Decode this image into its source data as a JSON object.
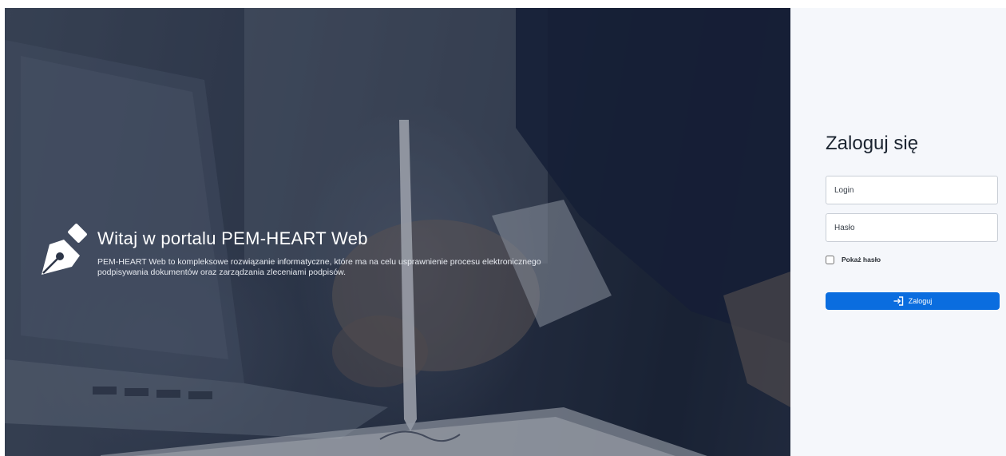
{
  "hero": {
    "title": "Witaj w portalu PEM-HEART Web",
    "description": "PEM-HEART Web to kompleksowe rozwiązanie informatyczne, które ma na celu usprawnienie procesu elektronicznego podpisywania dokumentów oraz zarządzania zleceniami podpisów.",
    "logo_icon": "fountain-pen-nib-icon"
  },
  "login": {
    "title": "Zaloguj się",
    "login_placeholder": "Login",
    "password_placeholder": "Hasło",
    "show_password_label": "Pokaż hasło",
    "show_password_checked": false,
    "submit_label": "Zaloguj",
    "submit_icon": "login-arrow-icon"
  },
  "colors": {
    "accent": "#0a6ddf",
    "panel_background": "#f5f7fb",
    "title_text": "#1b2430"
  }
}
